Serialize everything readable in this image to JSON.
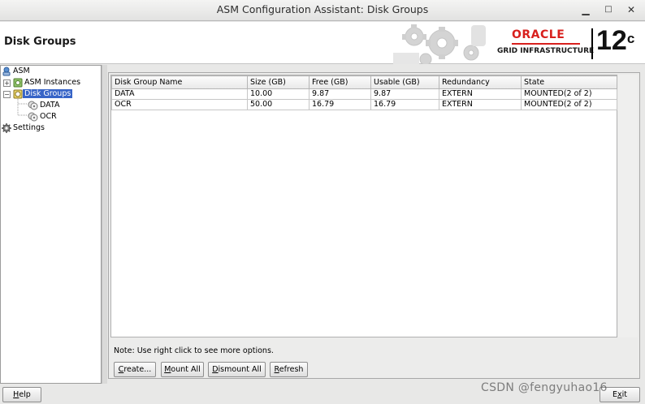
{
  "window": {
    "title": "ASM Configuration Assistant: Disk Groups",
    "minimize_glyph": "▁",
    "maximize_glyph": "□",
    "close_glyph": "✕"
  },
  "header": {
    "page_title": "Disk Groups",
    "brand": {
      "oracle": "ORACLE",
      "product": "GRID INFRASTRUCTURE",
      "version": "12",
      "version_sup": "c"
    },
    "colors": {
      "oracle_red": "#d8201d"
    }
  },
  "tree": {
    "root": {
      "label": "ASM",
      "icon": "asm-icon"
    },
    "instances": {
      "label": "ASM Instances",
      "icon": "instances-icon"
    },
    "disk_groups": {
      "label": "Disk Groups",
      "icon": "disk-groups-icon",
      "selected": true
    },
    "children": [
      {
        "label": "DATA",
        "icon": "disk-group-icon"
      },
      {
        "label": "OCR",
        "icon": "disk-group-icon"
      }
    ],
    "settings": {
      "label": "Settings",
      "icon": "gear-icon"
    },
    "colors": {
      "selection": "#3764c7"
    }
  },
  "table": {
    "columns": [
      "Disk Group Name",
      "Size (GB)",
      "Free (GB)",
      "Usable (GB)",
      "Redundancy",
      "State"
    ],
    "rows": [
      [
        "DATA",
        "10.00",
        "9.87",
        "9.87",
        "EXTERN",
        "MOUNTED(2 of 2)"
      ],
      [
        "OCR",
        "50.00",
        "16.79",
        "16.79",
        "EXTERN",
        "MOUNTED(2 of 2)"
      ]
    ]
  },
  "note": "Note: Use right click to see more options.",
  "buttons": {
    "create": {
      "mnemonic": "C",
      "rest": "reate..."
    },
    "mount_all": {
      "mnemonic": "M",
      "rest": "ount All"
    },
    "dismount_all": {
      "mnemonic": "D",
      "rest": "ismount All"
    },
    "refresh": {
      "mnemonic": "R",
      "rest": "efresh"
    },
    "help": {
      "mnemonic": "H",
      "rest": "elp"
    },
    "exit": {
      "pre": "E",
      "mnemonic": "x",
      "rest": "it"
    }
  },
  "watermark": "CSDN @fengyuhao16"
}
